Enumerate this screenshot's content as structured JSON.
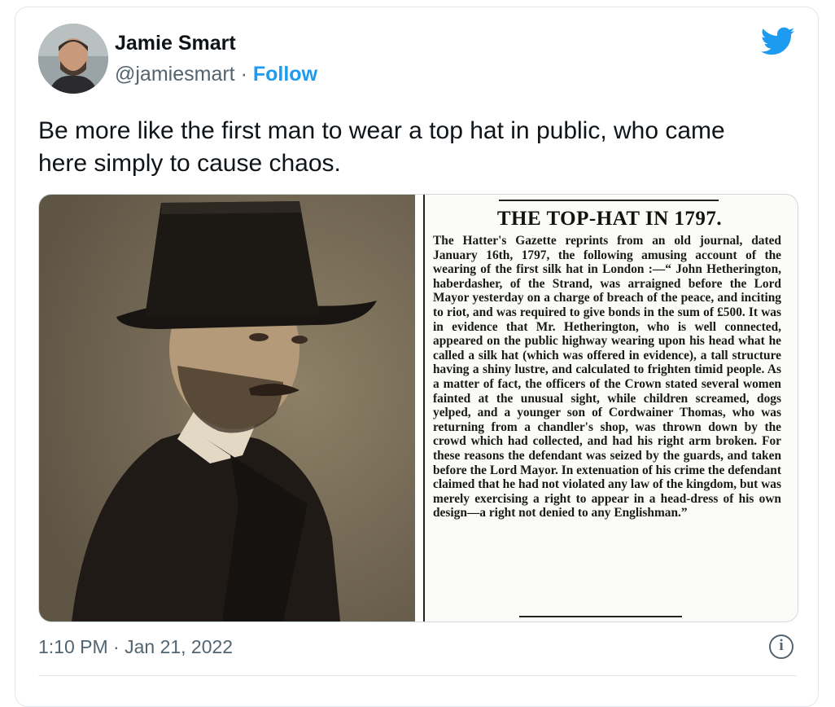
{
  "tweet": {
    "author_name": "Jamie Smart",
    "handle": "@jamiesmart",
    "separator": "·",
    "follow_label": "Follow",
    "text": "Be more like the first man to wear a top hat in public, who came here simply to cause chaos.",
    "timestamp": "1:10 PM · Jan 21, 2022",
    "info_glyph": "i"
  },
  "icons": {
    "brand": "twitter-bird-icon",
    "info": "info-icon"
  },
  "colors": {
    "accent": "#1d9bf0",
    "secondary_text": "#536471",
    "primary_text": "#0f1419",
    "border": "#e1e8ed"
  },
  "clipping": {
    "headline": "THE TOP-HAT IN 1797.",
    "body": "The Hatter's Gazette reprints from an old journal, dated January 16th, 1797, the following amusing account of the wearing of the first silk hat in London :—“ John Hetherington, haberdasher, of the Strand, was arraigned before the Lord Mayor yesterday on a charge of breach of the peace, and inciting to riot, and was required to give bonds in the sum of £500.   It was in evidence that Mr. Hetherington, who is well connected, appeared on the public highway wearing upon his head what he called a silk hat (which was offered in evidence), a tall structure having a shiny lustre, and calculated to frighten timid people.   As a matter of fact, the officers of the Crown stated several women fainted at the unusual sight, while children screamed, dogs yelped, and a younger son of Cordwainer Thomas, who was returning from a chandler's shop, was thrown down by the crowd which had collected, and had his right arm broken.  For these reasons the defendant was seized by the guards, and taken before the Lord Mayor.   In extenuation of his crime the defendant claimed that he had not violated any law of the kingdom, but was merely exercising a right to appear in a head-dress of his own design—a right not denied to any Englishman.”"
  }
}
